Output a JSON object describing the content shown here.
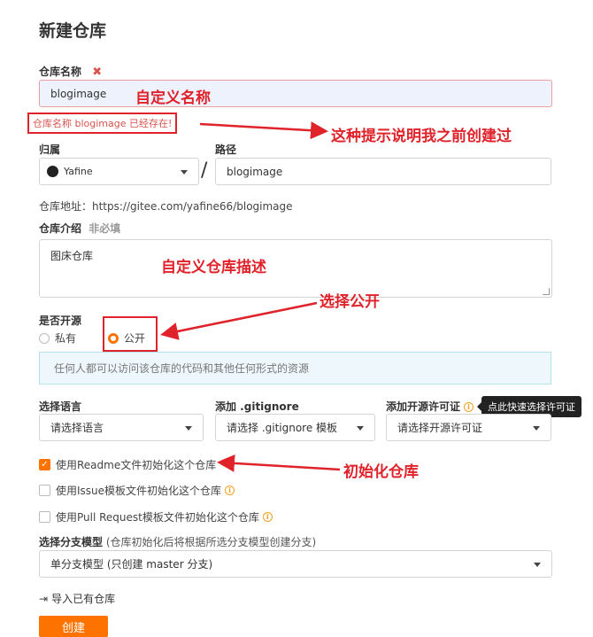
{
  "page": {
    "title": "新建仓库"
  },
  "repo_name": {
    "label": "仓库名称",
    "required_mark": "✖",
    "value": "blogimage",
    "error": "仓库名称 blogimage 已经存在!"
  },
  "owner": {
    "label": "归属",
    "value": "Yafine"
  },
  "path": {
    "label": "路径",
    "separator": "/",
    "value": "blogimage"
  },
  "repo_address": {
    "text": "仓库地址：https://gitee.com/yafine66/blogimage"
  },
  "description": {
    "label": "仓库介绍",
    "optional": "非必填",
    "value": "图床仓库"
  },
  "visibility": {
    "label": "是否开源",
    "options": [
      {
        "label": "私有",
        "selected": false
      },
      {
        "label": "公开",
        "selected": true
      }
    ],
    "notice": "任何人都可以访问该仓库的代码和其他任何形式的资源"
  },
  "language": {
    "label": "选择语言",
    "value": "请选择语言"
  },
  "gitignore": {
    "label": "添加 .gitignore",
    "value": "请选择 .gitignore 模板"
  },
  "license": {
    "label": "添加开源许可证",
    "value": "请选择开源许可证",
    "tooltip": "点此快速选择许可证"
  },
  "init_options": [
    {
      "label": "使用Readme文件初始化这个仓库",
      "checked": true,
      "info": false
    },
    {
      "label": "使用Issue模板文件初始化这个仓库",
      "checked": false,
      "info": true
    },
    {
      "label": "使用Pull Request模板文件初始化这个仓库",
      "checked": false,
      "info": true
    }
  ],
  "branch_model": {
    "label": "选择分支模型",
    "hint": "(仓库初始化后将根据所选分支模型创建分支)",
    "value": "单分支模型 (只创建 master 分支)"
  },
  "import_link": {
    "label": "导入已有仓库"
  },
  "submit": {
    "label": "创建"
  },
  "annotations": {
    "name": "自定义名称",
    "exists": "这种提示说明我之前创建过",
    "description": "自定义仓库描述",
    "public": "选择公开",
    "init": "初始化仓库"
  },
  "colors": {
    "accent": "#fe7300",
    "annotation": "#e0222a",
    "error_text": "#d9534f",
    "notice_bg": "#eef7fc"
  }
}
